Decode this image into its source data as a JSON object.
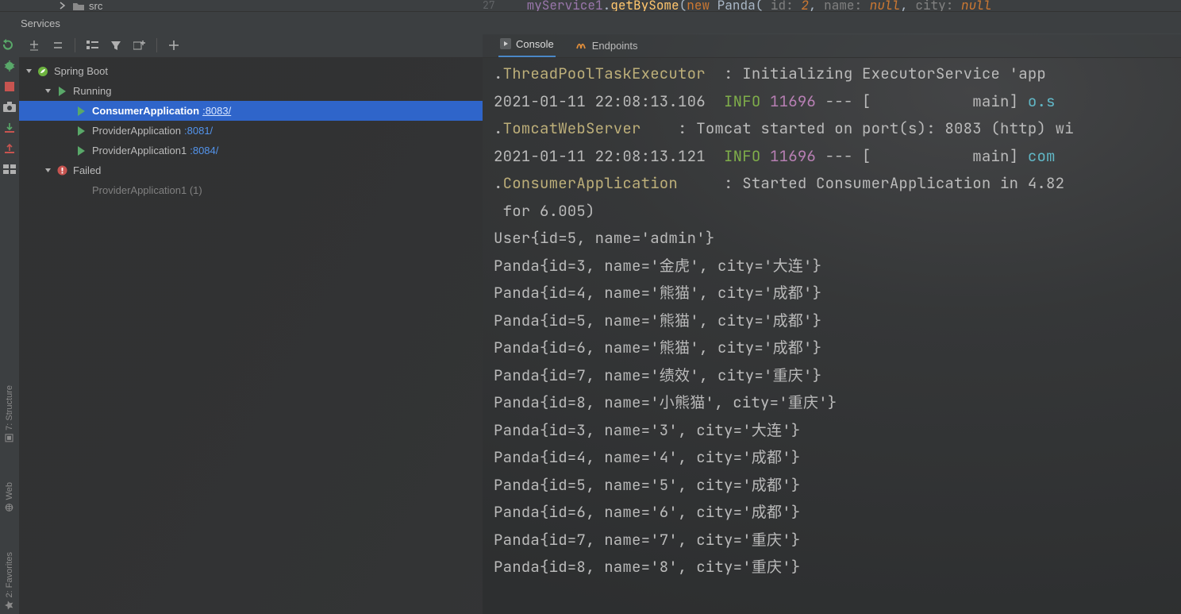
{
  "topbar": {
    "project_item": "src",
    "gutter_line": "27",
    "code_html": "<span class='tok-var'>myService1</span>.<span class='tok-call'>getBySome</span>(<span class='tok-kw'>new</span> <span class='tok-cls'>Panda</span>( <span class='tok-named'>id:</span> <span class='tok-lit'>2</span>, <span class='tok-named'>name:</span> <span class='tok-lit'>null</span>, <span class='tok-named'>city:</span> <span class='tok-lit'>null</span>"
  },
  "panel": {
    "title": "Services"
  },
  "sidebar": {
    "items": [
      "refresh",
      "debug",
      "stop",
      "snapshot",
      "export",
      "import",
      "layout"
    ],
    "bottom": [
      {
        "name": "structure",
        "label": "7: Structure"
      },
      {
        "name": "web",
        "label": "Web"
      },
      {
        "name": "favorites",
        "label": "2: Favorites"
      }
    ]
  },
  "tree_toolbar": [
    "expand-all",
    "collapse-all",
    "group-by",
    "filter",
    "add-config",
    "new"
  ],
  "tree": {
    "root": "Spring Boot",
    "groups": [
      {
        "name": "Running",
        "items": [
          {
            "label": "ConsumerApplication",
            "port": ":8083/",
            "selected": true
          },
          {
            "label": "ProviderApplication",
            "port": ":8081/"
          },
          {
            "label": "ProviderApplication1",
            "port": ":8084/"
          }
        ]
      },
      {
        "name": "Failed",
        "failed": true,
        "items": [
          {
            "label": "ProviderApplication1 (1)",
            "dim": true
          }
        ]
      }
    ]
  },
  "tabs": {
    "console": "Console",
    "endpoints": "Endpoints",
    "active": "console"
  },
  "console": {
    "lines": [
      {
        "pre": ".",
        "cls": "ThreadPoolTaskExecutor",
        "mid": "  : Initializing ExecutorService 'app"
      },
      {
        "ts": "2021-01-11 22:08:13.106  ",
        "lvl": "INFO",
        "pid": " 11696",
        "rest": " --- [           main] ",
        "tail": "o.s"
      },
      {
        "pre": ".",
        "cls": "TomcatWebServer",
        "mid": "    : Tomcat started on port(s): 8083 (http) wi"
      },
      {
        "ts": "2021-01-11 22:08:13.121  ",
        "lvl": "INFO",
        "pid": " 11696",
        "rest": " --- [           main] ",
        "tail": "com"
      },
      {
        "pre": ".",
        "cls": "ConsumerApplication",
        "mid": "     : Started ConsumerApplication in 4.82"
      },
      {
        "plain": " for 6.005)"
      },
      {
        "plain": "User{id=5, name='admin'}"
      },
      {
        "plain": "Panda{id=3, name='金虎', city='大连'}"
      },
      {
        "plain": "Panda{id=4, name='熊猫', city='成都'}"
      },
      {
        "plain": "Panda{id=5, name='熊猫', city='成都'}"
      },
      {
        "plain": "Panda{id=6, name='熊猫', city='成都'}"
      },
      {
        "plain": "Panda{id=7, name='绩效', city='重庆'}"
      },
      {
        "plain": "Panda{id=8, name='小熊猫', city='重庆'}"
      },
      {
        "plain": "Panda{id=3, name='3', city='大连'}"
      },
      {
        "plain": "Panda{id=4, name='4', city='成都'}"
      },
      {
        "plain": "Panda{id=5, name='5', city='成都'}"
      },
      {
        "plain": "Panda{id=6, name='6', city='成都'}"
      },
      {
        "plain": "Panda{id=7, name='7', city='重庆'}"
      },
      {
        "plain": "Panda{id=8, name='8', city='重庆'}"
      }
    ]
  },
  "icons": {
    "folder": "#b0b0b0",
    "play": "#59a869",
    "spring": "#6db33f",
    "fail": "#c75450",
    "endpoint": "#e08e3b",
    "run": "#59a869",
    "stop": "#c75450",
    "debug": "#59a869",
    "camera": "#b0b0b0",
    "grey": "#b0b0b0"
  }
}
